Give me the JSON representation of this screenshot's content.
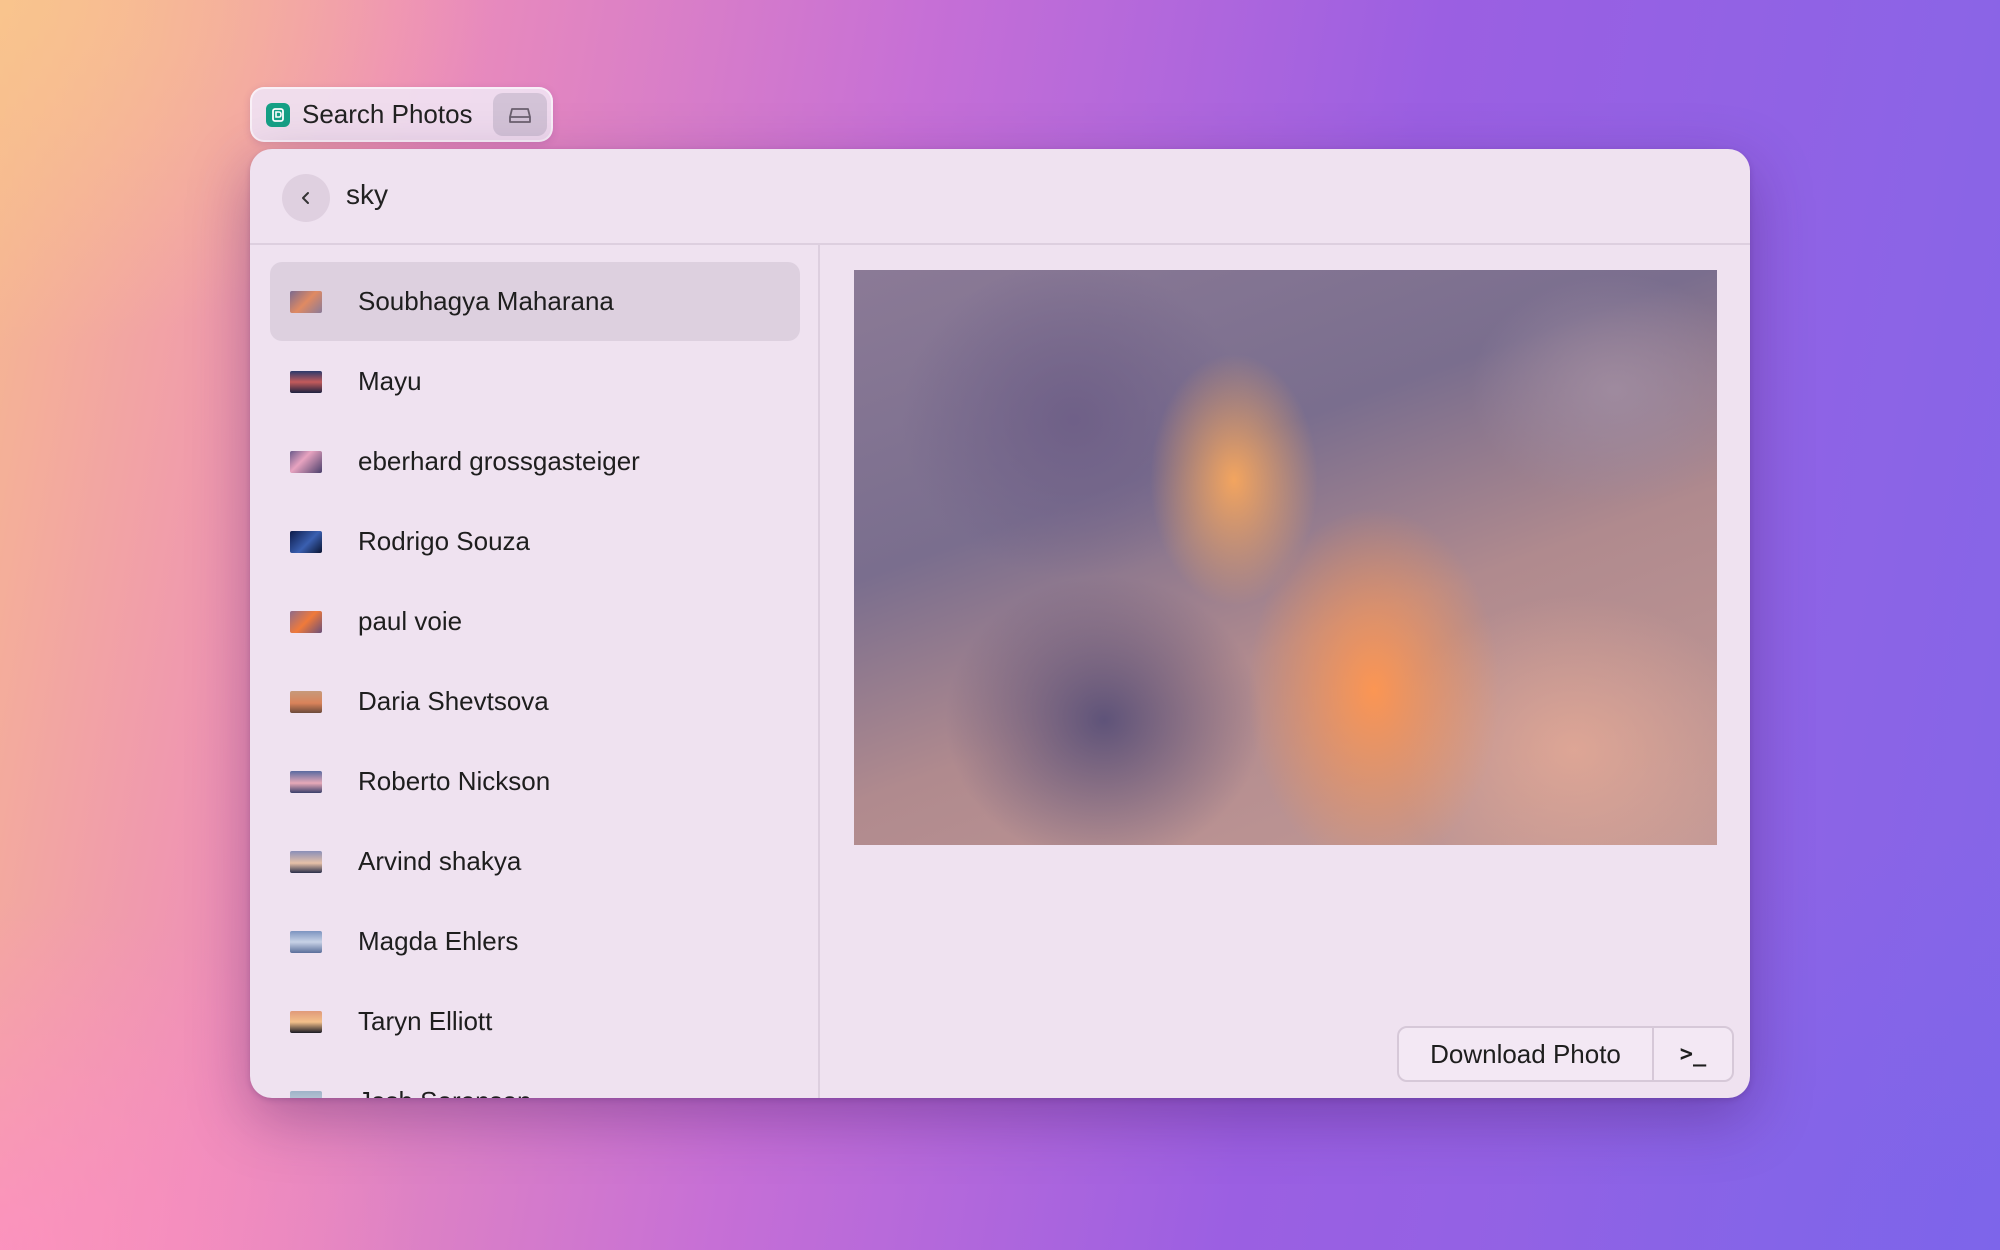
{
  "extension": {
    "title": "Search Photos",
    "icon": "photo-app-icon",
    "action_icon": "hard-drive-icon",
    "icon_color": "#16a085"
  },
  "search": {
    "back_icon": "chevron-left-icon",
    "query": "sky"
  },
  "results": [
    {
      "name": "Soubhagya Maharana",
      "selected": true,
      "thumb": "sunset-clouds"
    },
    {
      "name": "Mayu",
      "selected": false,
      "thumb": "horizon-dusk"
    },
    {
      "name": "eberhard grossgasteiger",
      "selected": false,
      "thumb": "pink-clouds"
    },
    {
      "name": "Rodrigo Souza",
      "selected": false,
      "thumb": "night-lightning"
    },
    {
      "name": "paul voie",
      "selected": false,
      "thumb": "orange-sky"
    },
    {
      "name": "Daria Shevtsova",
      "selected": false,
      "thumb": "desert-horizon"
    },
    {
      "name": "Roberto Nickson",
      "selected": false,
      "thumb": "mountain-dusk"
    },
    {
      "name": "Arvind shakya",
      "selected": false,
      "thumb": "sunset-tree"
    },
    {
      "name": "Magda Ehlers",
      "selected": false,
      "thumb": "blue-clouds"
    },
    {
      "name": "Taryn Elliott",
      "selected": false,
      "thumb": "sunset-silhouette"
    },
    {
      "name": "Josh Sorenson",
      "selected": false,
      "thumb": "pale-sky"
    }
  ],
  "preview": {
    "subject": "sunset-cumulus-clouds"
  },
  "actions": {
    "primary_label": "Download Photo",
    "menu_icon": "terminal-prompt-icon",
    "menu_glyph": ">_"
  }
}
